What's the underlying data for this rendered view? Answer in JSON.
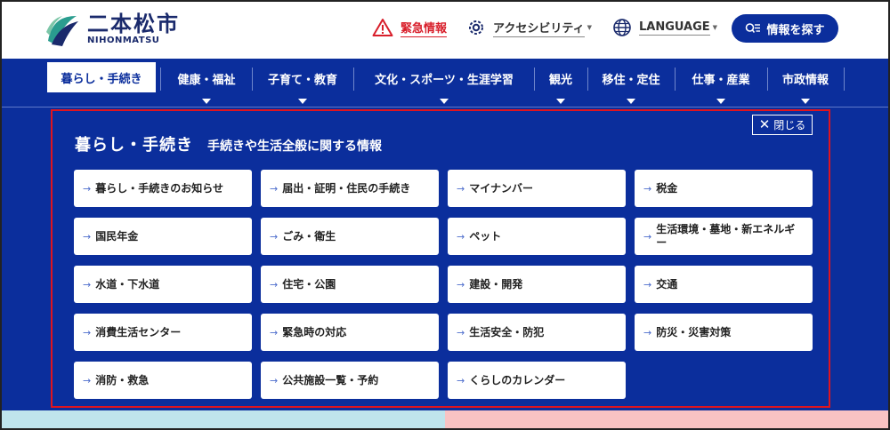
{
  "header": {
    "logo_name": "二本松市",
    "logo_roman": "NIHONMATSU",
    "emergency_label": "緊急情報",
    "accessibility_label": "アクセシビリティ",
    "language_label": "LANGUAGE",
    "search_label": "情報を探す"
  },
  "nav": {
    "items": [
      {
        "label": "暮らし・手続き"
      },
      {
        "label": "健康・福祉"
      },
      {
        "label": "子育て・教育"
      },
      {
        "label": "文化・スポーツ・生涯学習"
      },
      {
        "label": "観光"
      },
      {
        "label": "移住・定住"
      },
      {
        "label": "仕事・産業"
      },
      {
        "label": "市政情報"
      }
    ]
  },
  "panel": {
    "title": "暮らし・手続き",
    "subtitle": "手続きや生活全般に関する情報",
    "close_label": "閉じる",
    "links": [
      {
        "label": "暮らし・手続きのお知らせ"
      },
      {
        "label": "届出・証明・住民の手続き"
      },
      {
        "label": "マイナンバー"
      },
      {
        "label": "税金"
      },
      {
        "label": "国民年金"
      },
      {
        "label": "ごみ・衛生"
      },
      {
        "label": "ペット"
      },
      {
        "label": "生活環境・墓地・新エネルギー"
      },
      {
        "label": "水道・下水道"
      },
      {
        "label": "住宅・公園"
      },
      {
        "label": "建設・開発"
      },
      {
        "label": "交通"
      },
      {
        "label": "消費生活センター"
      },
      {
        "label": "緊急時の対応"
      },
      {
        "label": "生活安全・防犯"
      },
      {
        "label": "防災・災害対策"
      },
      {
        "label": "消防・救急"
      },
      {
        "label": "公共施設一覧・予約"
      },
      {
        "label": "くらしのカレンダー"
      }
    ]
  },
  "colors": {
    "brand_blue": "#0b2e9c",
    "emergency_red": "#d81e2a",
    "highlight_border": "#e0141e"
  },
  "icons": {
    "emergency": "warning-triangle-icon",
    "accessibility": "gear-icon",
    "language": "globe-icon",
    "search": "search-list-icon",
    "close": "close-icon",
    "link": "arrow-right-icon"
  }
}
